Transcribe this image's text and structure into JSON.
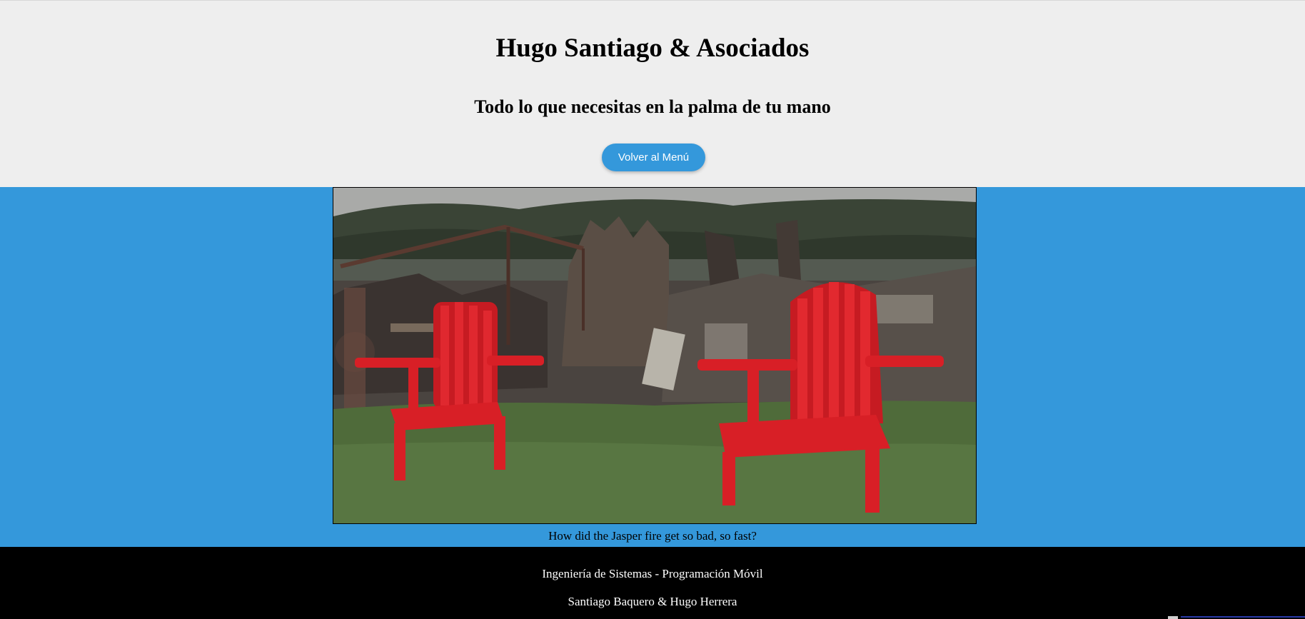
{
  "header": {
    "title": "Hugo Santiago & Asociados",
    "tagline": "Todo lo que necesitas en la palma de tu mano",
    "back_button_label": "Volver al Menú"
  },
  "main": {
    "image_alt": "How did the Jasper fire get so bad, so fast?",
    "caption": "How did the Jasper fire get so bad, so fast?"
  },
  "footer": {
    "line1": "Ingeniería de Sistemas - Programación Móvil",
    "line2": "Santiago Baquero & Hugo Herrera"
  },
  "colors": {
    "header_bg": "#eeeeee",
    "main_bg": "#3498db",
    "button_bg": "#3498db",
    "footer_bg": "#000000",
    "chair_red": "#d81f26"
  },
  "icons": {
    "broken_image": "broken-image-icon"
  }
}
